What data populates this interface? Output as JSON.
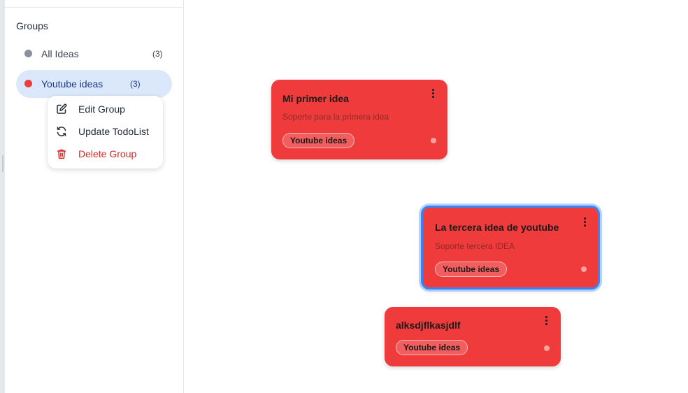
{
  "sidebar": {
    "heading": "Groups",
    "groups": [
      {
        "label": "All Ideas",
        "count": "(3)",
        "dot_color": "#8b919c",
        "selected": false
      },
      {
        "label": "Youtube ideas",
        "count": "(3)",
        "dot_color": "#ef3b3b",
        "selected": true
      }
    ]
  },
  "context_menu": {
    "items": [
      {
        "label": "Edit Group",
        "icon": "edit-icon"
      },
      {
        "label": "Update TodoList",
        "icon": "refresh-icon"
      },
      {
        "label": "Delete Group",
        "icon": "trash-icon",
        "color": "#dc2626"
      }
    ]
  },
  "cards": [
    {
      "title": "Mi primer idea",
      "subtitle": "Soporte para la primera idea",
      "tag": "Youtube ideas",
      "selected": false
    },
    {
      "title": "La tercera idea de youtube",
      "subtitle": "Soporte tercera IDEA",
      "tag": "Youtube ideas",
      "selected": true
    },
    {
      "title": "alksdjflkasjdlf",
      "subtitle": "",
      "tag": "Youtube ideas",
      "selected": false
    }
  ],
  "colors": {
    "card": "#ef3b3b",
    "selected_group_bg": "#dbe8fb",
    "selection_border": "#3b82f6",
    "danger": "#dc2626"
  }
}
